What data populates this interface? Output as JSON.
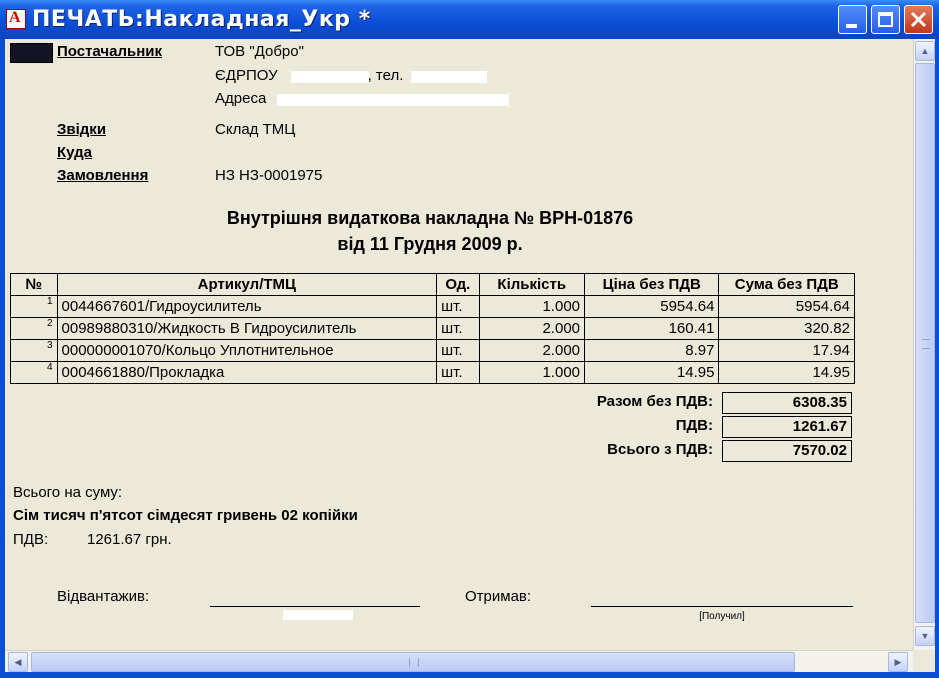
{
  "window": {
    "title": "ПЕЧАТЬ:Накладная_Укр  *",
    "app_icon": "acrobat-icon"
  },
  "supplier": {
    "label": "Постачальник",
    "name": "ТОВ \"Добро\"",
    "edrpou_prefix": "ЄДРПОУ",
    "phone_label": ", тел.",
    "address_label": "Адреса"
  },
  "from": {
    "label": "Звідки",
    "value": "Склад ТМЦ"
  },
  "to": {
    "label": "Куда",
    "value": ""
  },
  "order": {
    "label": "Замовлення",
    "value": "НЗ НЗ-0001975"
  },
  "document": {
    "title": "Внутрішня видаткова накладна № ВРН-01876",
    "date": "від 11 Грудня 2009 р."
  },
  "table": {
    "headers": [
      "№",
      "Артикул/ТМЦ",
      "Од.",
      "Кількість",
      "Ціна без ПДВ",
      "Сума без ПДВ"
    ],
    "rows": [
      {
        "num": "1",
        "article": "0044667601/Гидроусилитель",
        "unit": "шт.",
        "qty": "1.000",
        "price": "5954.64",
        "sum": "5954.64"
      },
      {
        "num": "2",
        "article": "00989880310/Жидкость В Гидроусилитель",
        "unit": "шт.",
        "qty": "2.000",
        "price": "160.41",
        "sum": "320.82"
      },
      {
        "num": "3",
        "article": "000000001070/Кольцо Уплотнительное",
        "unit": "шт.",
        "qty": "2.000",
        "price": "8.97",
        "sum": "17.94"
      },
      {
        "num": "4",
        "article": "0004661880/Прокладка",
        "unit": "шт.",
        "qty": "1.000",
        "price": "14.95",
        "sum": "14.95"
      }
    ]
  },
  "totals": {
    "subtotal_label": "Разом без ПДВ:",
    "subtotal": "6308.35",
    "vat_label": "ПДВ:",
    "vat": "1261.67",
    "total_label": "Всього з ПДВ:",
    "total": "7570.02"
  },
  "summary": {
    "label": "Всього на суму:",
    "words": "Сім тисяч п'ятсот сімдесят гривень 02 копійки",
    "vat_label": "ПДВ:",
    "vat_value": "1261.67 грн."
  },
  "signatures": {
    "shipped_label": "Відвантажив:",
    "received_label": "Отримав:",
    "received_caption": "[Получил]"
  }
}
